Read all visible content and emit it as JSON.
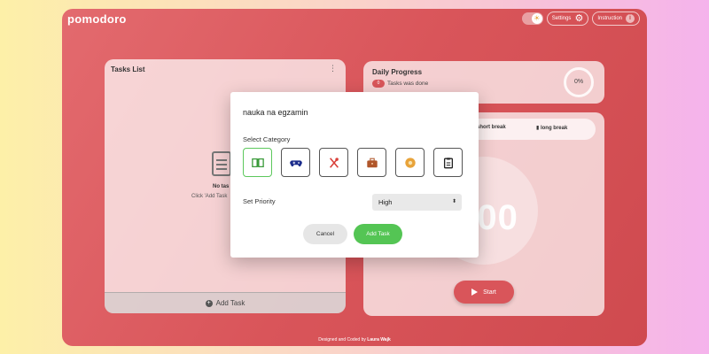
{
  "app": {
    "logo": "pomodoro"
  },
  "header": {
    "settings_label": "Settings",
    "instruction_label": "Instruction",
    "theme_toggle_icon": "sun-icon",
    "settings_icon": "gear-icon",
    "instruction_icon": "info-icon",
    "info_glyph": "i"
  },
  "tasks": {
    "title": "Tasks List",
    "empty_title": "No tas",
    "empty_hint": "Click 'Add Task",
    "add_task_label": "Add Task"
  },
  "progress": {
    "title": "Daily Progress",
    "done_count": "0",
    "done_text": "Tasks was done",
    "percent": "0%"
  },
  "timer": {
    "mode_short": "short break",
    "mode_long": "long break",
    "time_display": ":00",
    "start_label": "Start"
  },
  "footer": {
    "text": "Designed and Coded by",
    "author": "Laura Wajk"
  },
  "modal": {
    "task_name_value": "nauka na egzamin",
    "category_label": "Select Category",
    "categories": [
      {
        "icon": "book-icon",
        "color": "#3a9a3a",
        "selected": true
      },
      {
        "icon": "gamepad-icon",
        "color": "#1c2d8c",
        "selected": false
      },
      {
        "icon": "utensils-icon",
        "color": "#d9403a",
        "selected": false
      },
      {
        "icon": "briefcase-icon",
        "color": "#b0562a",
        "selected": false
      },
      {
        "icon": "ball-icon",
        "color": "#e8a33a",
        "selected": false
      },
      {
        "icon": "clipboard-icon",
        "color": "#222222",
        "selected": false
      }
    ],
    "priority_label": "Set Priority",
    "priority_value": "High",
    "cancel_label": "Cancel",
    "add_label": "Add Task"
  },
  "colors": {
    "accent": "#d9555a",
    "confirm": "#54c554"
  }
}
